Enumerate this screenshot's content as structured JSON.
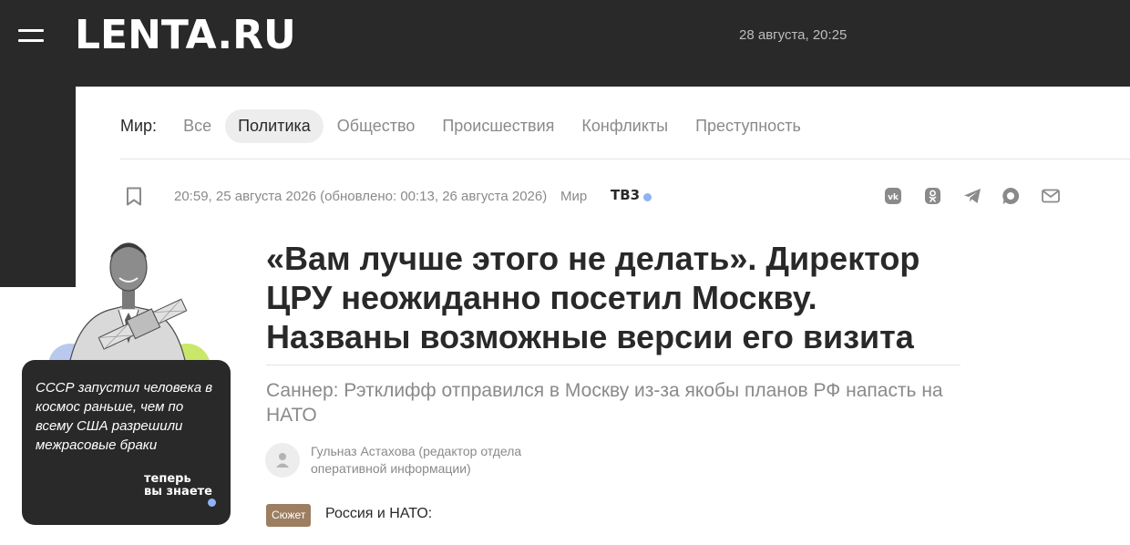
{
  "header": {
    "logo": "LENTA.RU",
    "date": "28 августа, 20:25"
  },
  "rubrics": {
    "title": "Мир:",
    "items": [
      {
        "label": "Все",
        "active": false
      },
      {
        "label": "Политика",
        "active": true
      },
      {
        "label": "Общество",
        "active": false
      },
      {
        "label": "Происшествия",
        "active": false
      },
      {
        "label": "Конфликты",
        "active": false
      },
      {
        "label": "Преступность",
        "active": false
      }
    ]
  },
  "article": {
    "meta": "20:59, 25 августа 2026 (обновлено: 00:13, 26 августа 2026)",
    "rubric": "Мир",
    "partner": "ТВ3",
    "headline": "«Вам лучше этого не делать». Директор ЦРУ неожиданно посетил Москву. Названы возможные версии его визита",
    "subtitle": "Саннер: Рэтклифф отправился в Москву из-за якобы планов РФ напасть на НАТО",
    "author": "Гульназ Астахова (редактор отдела оперативной информации)",
    "story_badge": "Сюжет",
    "story_title": "Россия и НАТО:"
  },
  "share": {
    "icons": [
      "vk-icon",
      "odnoklassniki-icon",
      "telegram-icon",
      "max-messenger-icon",
      "mail-icon"
    ]
  },
  "promo": {
    "text": "СССР запустил человека в космос раньше, чем по всему США разрешили межрасовые браки",
    "brand_line1": "теперь",
    "brand_line2": "вы знаете"
  },
  "colors": {
    "dark": "#292929",
    "accent_dot": "#8fb2f2",
    "badge": "#9c7e61",
    "muted_text": "#8a8a8a"
  }
}
